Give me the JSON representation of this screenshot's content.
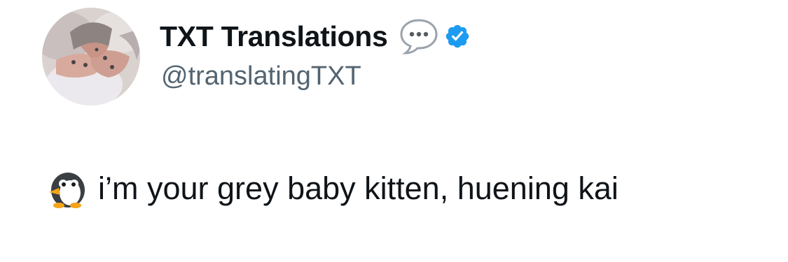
{
  "author": {
    "display_name": "TXT Translations",
    "handle": "@translatingTXT",
    "verified": true,
    "avatar_icon": "hands-photo-avatar",
    "name_emoji_icon": "speech-balloon-icon",
    "verified_icon": "verified-badge-icon"
  },
  "tweet": {
    "emoji_icon": "penguin-icon",
    "text": "i’m your grey baby kitten, huening kai"
  },
  "colors": {
    "name": "#0f1419",
    "handle": "#536471",
    "verified": "#1d9bf0",
    "background": "#ffffff"
  }
}
